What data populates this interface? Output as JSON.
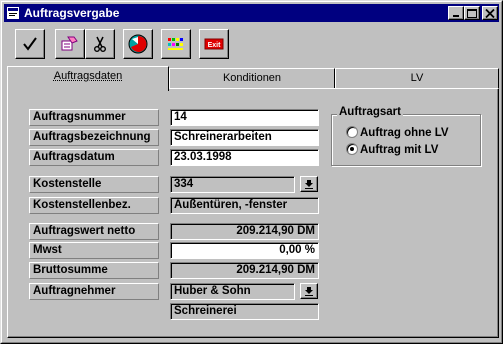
{
  "window": {
    "title": "Auftragsvergabe"
  },
  "toolbar": {
    "exit_label": "Exit"
  },
  "tabs": [
    {
      "label": "Auftragsdaten"
    },
    {
      "label": "Konditionen"
    },
    {
      "label": "LV"
    }
  ],
  "form": {
    "auftragsnummer": {
      "label": "Auftragsnummer",
      "value": "14"
    },
    "auftragsbezeichnung": {
      "label": "Auftragsbezeichnung",
      "value": "Schreinerarbeiten"
    },
    "auftragsdatum": {
      "label": "Auftragsdatum",
      "value": "23.03.1998"
    },
    "kostenstelle": {
      "label": "Kostenstelle",
      "value": "334"
    },
    "kostenstellenbez": {
      "label": "Kostenstellenbez.",
      "value": "Außentüren, -fenster"
    },
    "auftragswert_netto": {
      "label": "Auftragswert netto",
      "value": "209.214,90 DM"
    },
    "mwst": {
      "label": "Mwst",
      "value": "0,00 %"
    },
    "bruttosumme": {
      "label": "Bruttosumme",
      "value": "209.214,90 DM"
    },
    "auftragnehmer": {
      "label": "Auftragnehmer",
      "value": "Huber & Sohn",
      "trade": "Schreinerei"
    }
  },
  "auftragsart": {
    "title": "Auftragsart",
    "options": [
      {
        "label": "Auftrag ohne LV",
        "selected": false
      },
      {
        "label": "Auftrag mit LV",
        "selected": true
      }
    ]
  }
}
